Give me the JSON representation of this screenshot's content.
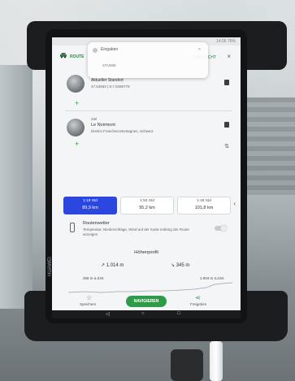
{
  "device": {
    "brand": "HUAWEI"
  },
  "appbar": {
    "title": "ROUTE",
    "right_label": "ÜBERSICHT",
    "close": "×"
  },
  "notification": {
    "title": "Eingaben",
    "body": "STUMM"
  },
  "start": {
    "name": "Aktueller Standort",
    "coords": "47.54563 | 8.7.0286779"
  },
  "destination": {
    "label": "Ziel",
    "name": "Le Noirmont",
    "region": "District Franches-Montagnes, Schweiz"
  },
  "routes": [
    {
      "time": "1:19 Std",
      "distance": "89,9 km",
      "active": true
    },
    {
      "time": "1:50 Std",
      "distance": "95,2 km",
      "active": false
    },
    {
      "time": "1:49 Std",
      "distance": "101,8 km",
      "active": false
    }
  ],
  "weather": {
    "title": "Routenwetter",
    "description": "Temperatur, Niederschläge, Wind auf der Karte entlang der Route anzeigen"
  },
  "profile": {
    "title": "Höhenprofil",
    "ascent": "1.014 m",
    "descent": "345 m",
    "scale_left": "256 m ü.d.M.",
    "scale_right": "1.004 m ü.d.M."
  },
  "bottom": {
    "save_label": "Speichern",
    "navigate_label": "NAVIGIEREN",
    "share_label": "Freigeben"
  },
  "statusbar": {
    "right": "14:26 76%"
  }
}
